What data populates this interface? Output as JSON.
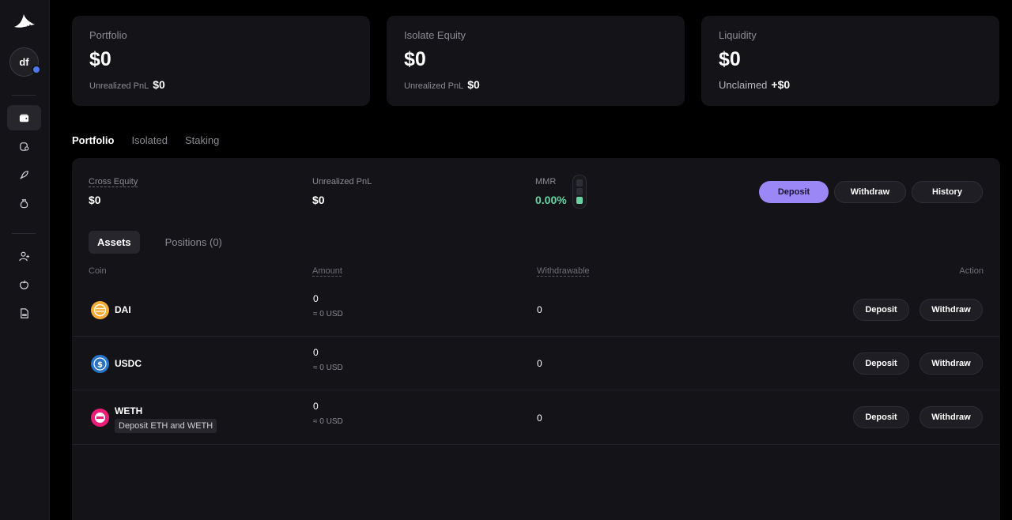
{
  "sidebar": {
    "avatar_initials": "df",
    "nav_top": [
      {
        "icon": "wallet-icon",
        "active": true
      },
      {
        "icon": "coin-bag-icon",
        "active": false
      },
      {
        "icon": "rocket-icon",
        "active": false
      },
      {
        "icon": "money-bag-icon",
        "active": false
      }
    ],
    "nav_bottom": [
      {
        "icon": "add-user-icon"
      },
      {
        "icon": "apple-icon"
      },
      {
        "icon": "document-icon"
      }
    ]
  },
  "cards": [
    {
      "title": "Portfolio",
      "value": "$0",
      "sub_label": "Unrealized PnL",
      "sub_value": "$0"
    },
    {
      "title": "Isolate Equity",
      "value": "$0",
      "sub_label": "Unrealized PnL",
      "sub_value": "$0"
    },
    {
      "title": "Liquidity",
      "value": "$0",
      "sub_label": "Unclaimed",
      "sub_value": "+$0"
    }
  ],
  "top_tabs": {
    "portfolio": "Portfolio",
    "isolated": "Isolated",
    "staking": "Staking"
  },
  "stats": {
    "cross_equity_label": "Cross Equity",
    "cross_equity_value": "$0",
    "unrealized_label": "Unrealized PnL",
    "unrealized_value": "$0",
    "mmr_label": "MMR",
    "mmr_value": "0.00%"
  },
  "actions": {
    "deposit": "Deposit",
    "withdraw": "Withdraw",
    "history": "History"
  },
  "sub_tabs": {
    "assets": "Assets",
    "positions": "Positions (0)"
  },
  "table": {
    "headers": {
      "coin": "Coin",
      "amount": "Amount",
      "withdrawable": "Withdrawable",
      "action": "Action"
    },
    "rows": [
      {
        "coin": "DAI",
        "amount": "0",
        "usd": "≈ 0 USD",
        "withdrawable": "0",
        "note": "",
        "deposit": "Deposit",
        "withdraw": "Withdraw"
      },
      {
        "coin": "USDC",
        "amount": "0",
        "usd": "≈ 0 USD",
        "withdrawable": "0",
        "note": "",
        "deposit": "Deposit",
        "withdraw": "Withdraw"
      },
      {
        "coin": "WETH",
        "amount": "0",
        "usd": "≈ 0 USD",
        "withdrawable": "0",
        "note": "Deposit ETH and WETH",
        "deposit": "Deposit",
        "withdraw": "Withdraw"
      }
    ]
  },
  "colors": {
    "accent": "#9b87f5",
    "positive": "#6ad1a0",
    "dai": "#f5ac37",
    "usdc": "#2775ca",
    "weth": "#ec1c79"
  }
}
